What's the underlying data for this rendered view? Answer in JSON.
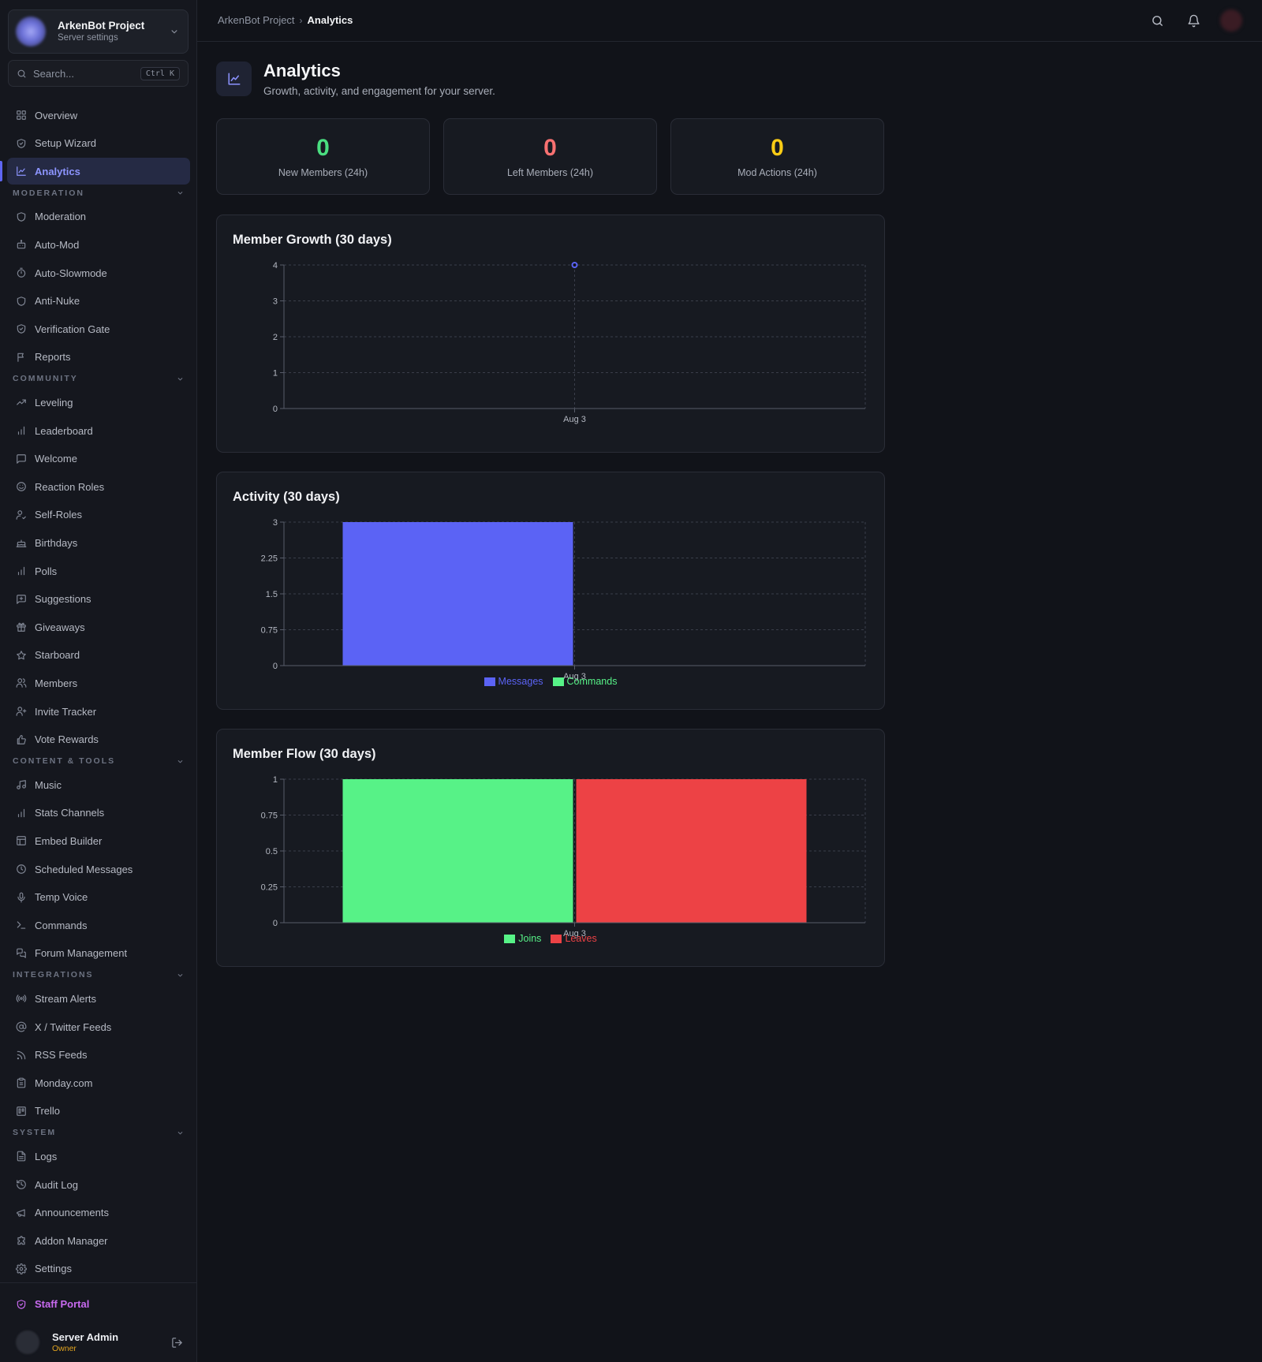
{
  "project": {
    "name": "ArkenBot Project",
    "subtitle": "Server settings"
  },
  "search": {
    "placeholder": "Search...",
    "shortcut": "Ctrl K"
  },
  "nav": {
    "top": [
      {
        "label": "Overview",
        "icon": "grid-icon"
      },
      {
        "label": "Setup Wizard",
        "icon": "shield-check-icon"
      },
      {
        "label": "Analytics",
        "icon": "line-chart-icon",
        "active": true
      }
    ],
    "sections": [
      {
        "title": "MODERATION",
        "items": [
          {
            "label": "Moderation",
            "icon": "shield-icon"
          },
          {
            "label": "Auto-Mod",
            "icon": "bot-icon"
          },
          {
            "label": "Auto-Slowmode",
            "icon": "timer-icon"
          },
          {
            "label": "Anti-Nuke",
            "icon": "shield-icon"
          },
          {
            "label": "Verification Gate",
            "icon": "shield-check-icon"
          },
          {
            "label": "Reports",
            "icon": "flag-icon"
          }
        ]
      },
      {
        "title": "COMMUNITY",
        "items": [
          {
            "label": "Leveling",
            "icon": "trending-up-icon"
          },
          {
            "label": "Leaderboard",
            "icon": "bar-chart-icon"
          },
          {
            "label": "Welcome",
            "icon": "message-square-icon"
          },
          {
            "label": "Reaction Roles",
            "icon": "smile-icon"
          },
          {
            "label": "Self-Roles",
            "icon": "user-check-icon"
          },
          {
            "label": "Birthdays",
            "icon": "cake-icon"
          },
          {
            "label": "Polls",
            "icon": "bar-chart-icon"
          },
          {
            "label": "Suggestions",
            "icon": "message-square-plus-icon"
          },
          {
            "label": "Giveaways",
            "icon": "gift-icon"
          },
          {
            "label": "Starboard",
            "icon": "star-icon"
          },
          {
            "label": "Members",
            "icon": "users-icon"
          },
          {
            "label": "Invite Tracker",
            "icon": "user-plus-icon"
          },
          {
            "label": "Vote Rewards",
            "icon": "thumbs-up-icon"
          }
        ]
      },
      {
        "title": "CONTENT & TOOLS",
        "items": [
          {
            "label": "Music",
            "icon": "music-icon"
          },
          {
            "label": "Stats Channels",
            "icon": "bar-chart-icon"
          },
          {
            "label": "Embed Builder",
            "icon": "layout-icon"
          },
          {
            "label": "Scheduled Messages",
            "icon": "clock-icon"
          },
          {
            "label": "Temp Voice",
            "icon": "mic-icon"
          },
          {
            "label": "Commands",
            "icon": "terminal-icon"
          },
          {
            "label": "Forum Management",
            "icon": "messages-icon"
          }
        ]
      },
      {
        "title": "INTEGRATIONS",
        "items": [
          {
            "label": "Stream Alerts",
            "icon": "radio-icon"
          },
          {
            "label": "X / Twitter Feeds",
            "icon": "at-sign-icon"
          },
          {
            "label": "RSS Feeds",
            "icon": "rss-icon"
          },
          {
            "label": "Monday.com",
            "icon": "clipboard-icon"
          },
          {
            "label": "Trello",
            "icon": "trello-icon"
          }
        ]
      },
      {
        "title": "SYSTEM",
        "items": [
          {
            "label": "Logs",
            "icon": "file-text-icon"
          },
          {
            "label": "Audit Log",
            "icon": "history-icon"
          },
          {
            "label": "Announcements",
            "icon": "megaphone-icon"
          },
          {
            "label": "Addon Manager",
            "icon": "puzzle-icon"
          },
          {
            "label": "Settings",
            "icon": "gear-icon"
          }
        ]
      }
    ]
  },
  "footer": {
    "staff_label": "Staff Portal",
    "user_name": "Server Admin",
    "user_role": "Owner"
  },
  "breadcrumb": {
    "parent": "ArkenBot Project",
    "separator": "›",
    "current": "Analytics"
  },
  "page": {
    "title": "Analytics",
    "subtitle": "Growth, activity, and engagement for your server."
  },
  "stats": [
    {
      "value": "0",
      "label": "New Members (24h)",
      "color": "#4ade80"
    },
    {
      "value": "0",
      "label": "Left Members (24h)",
      "color": "#f87171"
    },
    {
      "value": "0",
      "label": "Mod Actions (24h)",
      "color": "#facc15"
    }
  ],
  "colors": {
    "accent": "#5b63f5",
    "messages": "#5b63f5",
    "commands": "#57f287",
    "joins": "#57f287",
    "leaves": "#ed4245"
  },
  "chart_data": [
    {
      "type": "line",
      "title": "Member Growth (30 days)",
      "categories": [
        "Aug 3"
      ],
      "series": [
        {
          "values": [
            4
          ]
        }
      ],
      "ylim": [
        0,
        4
      ],
      "yticks": [
        "0",
        "1",
        "2",
        "3",
        "4"
      ],
      "grid": true
    },
    {
      "type": "bar",
      "title": "Activity (30 days)",
      "categories": [
        "Aug 3"
      ],
      "series": [
        {
          "name": "Messages",
          "values": [
            3
          ]
        },
        {
          "name": "Commands",
          "values": [
            0
          ]
        }
      ],
      "ylim": [
        0,
        3
      ],
      "yticks": [
        "0",
        "0.75",
        "1.5",
        "2.25",
        "3"
      ],
      "grid": true,
      "legend": "bottom"
    },
    {
      "type": "bar",
      "title": "Member Flow (30 days)",
      "categories": [
        "Aug 3"
      ],
      "series": [
        {
          "name": "Joins",
          "values": [
            1
          ]
        },
        {
          "name": "Leaves",
          "values": [
            1
          ]
        }
      ],
      "ylim": [
        0,
        1
      ],
      "yticks": [
        "0",
        "0.25",
        "0.5",
        "0.75",
        "1"
      ],
      "grid": true,
      "legend": "bottom"
    }
  ]
}
